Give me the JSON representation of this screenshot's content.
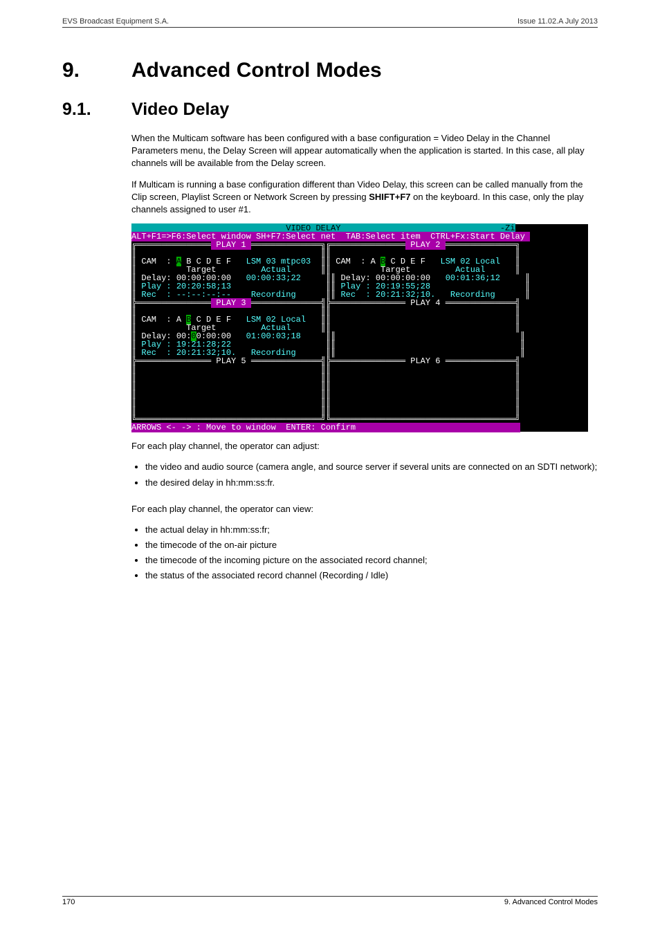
{
  "header": {
    "left": "EVS Broadcast Equipment S.A.",
    "right": "Issue 11.02.A  July 2013"
  },
  "section9": {
    "num": "9.",
    "title": "Advanced Control Modes"
  },
  "section91": {
    "num": "9.1.",
    "title": "Video Delay"
  },
  "para1": "When the Multicam software has been configured with a base configuration = Video Delay in the Channel Parameters menu, the Delay Screen will appear automatically when the application is started. In this case, all play channels will be available from the Delay screen.",
  "para2a": "If Multicam is running a base configuration different than Video Delay, this screen can be called manually from the Clip screen, Playlist Screen or Network Screen by pressing ",
  "para2b": "SHIFT+F7",
  "para2c": " on the keyboard. In this case, only the play channels assigned to user #1.",
  "term": {
    "title_left": "                               ",
    "title_mid": "VIDEO DELAY",
    "title_right": "                                -Zi",
    "menu_a": "ALT+F1=>F6:Select window",
    "menu_b": " SH+F7:Select net  ",
    "menu_c": "TAB:Select item  ",
    "menu_d": "CTRL+Fx:Start Delay ",
    "pane1_hdr": " PLAY 1 ",
    "pane2_hdr": " PLAY 2 ",
    "pane3_hdr": " PLAY 3 ",
    "pane4_hdr": " PLAY 4 ",
    "pane5_hdr": " PLAY 5 ",
    "pane6_hdr": " PLAY 6 ",
    "p1": {
      "cam_pre": " CAM  : ",
      "sel": "A",
      "cam_post": " B C D E F",
      "right": "   LSM 03 mtpc03 ",
      "target_l": "          Target",
      "target_r": "         Actual     ",
      "delay_l": " Delay: 00:00:00:00",
      "delay_r": "   00:00:33;22    ",
      "play": " Play : 20:20:58;13                   ",
      "rec_l": " Rec  : --:--:--:--",
      "rec_r": "    Recording     "
    },
    "p2": {
      "cam_pre": " CAM  : A ",
      "sel": "B",
      "cam_post": " C D E F",
      "right": "   LSM 02 Local  ",
      "target_l": "          Target",
      "target_r": "         Actual     ",
      "delay_l": " Delay: 00:00:00:00",
      "delay_r": "   00:01:36;12    ",
      "play": " Play : 20:19:55;28                   ",
      "rec_l": " Rec  : 20:21:32;10.",
      "rec_r": "   Recording     "
    },
    "p3": {
      "cam_pre": " CAM  : A ",
      "sel": "B",
      "cam_post": " C D E F",
      "right": "   LSM 02 Local  ",
      "target_l": "          Target",
      "target_r": "         Actual     ",
      "delay_pre": " Delay: 00:",
      "delay_sel": "0",
      "delay_post": "0:00:00",
      "delay_r": "   01:00:03;18    ",
      "play": " Play : 19:21:28;22                   ",
      "rec_l": " Rec  : 20:21:32;10.",
      "rec_r": "   Recording     "
    },
    "bottombar": "ARROWS <- -> : Move to window  ENTER: Confirm                                 "
  },
  "afterterm1": "For each play channel, the operator can adjust:",
  "adj_bullets": [
    "the video and audio source (camera angle, and source server if several units are connected on an SDTI network);",
    "the desired delay in hh:mm:ss:fr."
  ],
  "afterterm2": "For each play channel, the operator can view:",
  "view_bullets": [
    "the actual delay in hh:mm:ss:fr;",
    "the timecode of the on-air picture",
    "the timecode of the incoming picture on the associated record channel;",
    "the status of the associated record channel (Recording / Idle)"
  ],
  "footer": {
    "left": "170",
    "right": "9. Advanced Control Modes"
  }
}
